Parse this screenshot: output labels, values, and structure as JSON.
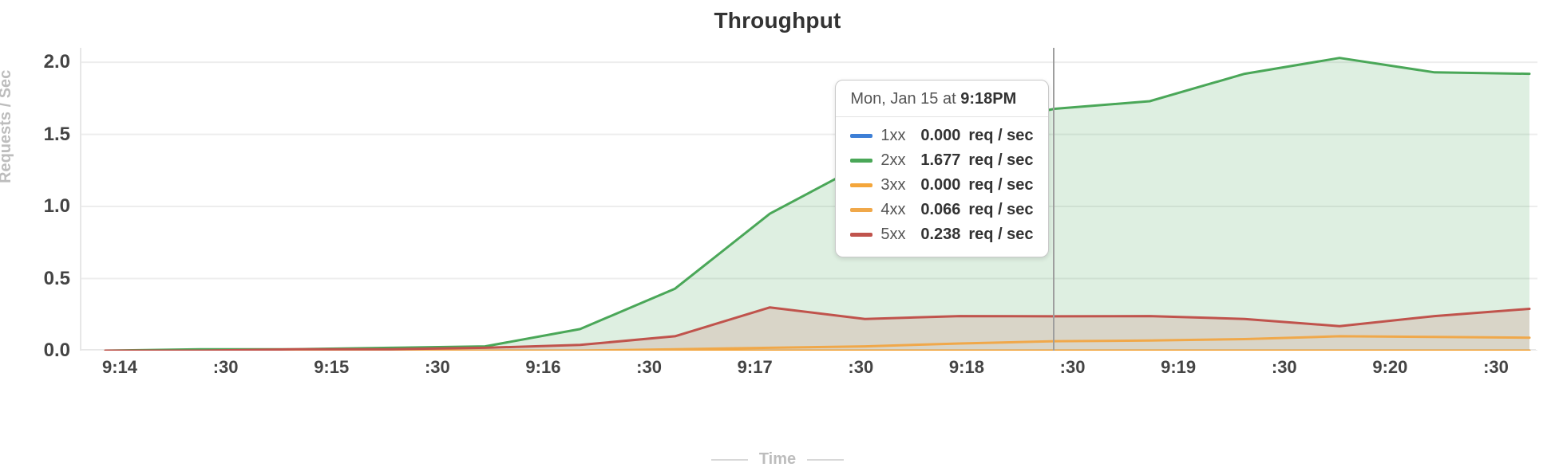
{
  "title": "Throughput",
  "ylabel": "Requests / Sec",
  "xlabel": "Time",
  "colors": {
    "s1xx": "#3d7fd6",
    "s2xx": "#4aa758",
    "s2xx_fill": "rgba(74,167,88,0.18)",
    "s3xx": "#f4a63b",
    "s4xx": "#f0a84a",
    "s5xx": "#c0534c",
    "s5xx_fill": "rgba(192,83,76,0.16)"
  },
  "y_ticks": [
    "0.0",
    "0.5",
    "1.0",
    "1.5",
    "2.0"
  ],
  "x_ticks": [
    "9:14",
    ":30",
    "9:15",
    ":30",
    "9:16",
    ":30",
    "9:17",
    ":30",
    "9:18",
    ":30",
    "9:19",
    ":30",
    "9:20",
    ":30"
  ],
  "tooltip": {
    "prefix": "Mon, Jan 15 at ",
    "time": "9:18PM",
    "unit": "req / sec",
    "rows": [
      {
        "label": "1xx",
        "value": "0.000",
        "colorKey": "s1xx"
      },
      {
        "label": "2xx",
        "value": "1.677",
        "colorKey": "s2xx"
      },
      {
        "label": "3xx",
        "value": "0.000",
        "colorKey": "s3xx"
      },
      {
        "label": "4xx",
        "value": "0.066",
        "colorKey": "s4xx"
      },
      {
        "label": "5xx",
        "value": "0.238",
        "colorKey": "s5xx"
      }
    ],
    "hover_x_label_index": 9
  },
  "chart_data": {
    "type": "area",
    "title": "Throughput",
    "xlabel": "Time",
    "ylabel": "Requests / Sec",
    "ylim": [
      0,
      2.1
    ],
    "x": [
      "9:14:00",
      "9:14:30",
      "9:15:00",
      "9:15:30",
      "9:16:00",
      "9:16:30",
      "9:17:00",
      "9:17:30",
      "9:18:00",
      "9:18:30",
      "9:18:48",
      "9:19:00",
      "9:19:30",
      "9:20:00",
      "9:20:30",
      "9:20:48"
    ],
    "series": [
      {
        "name": "1xx",
        "color": "#3d7fd6",
        "values": [
          0,
          0,
          0,
          0,
          0,
          0,
          0,
          0,
          0,
          0,
          0,
          0,
          0,
          0,
          0,
          0
        ]
      },
      {
        "name": "2xx",
        "color": "#4aa758",
        "fill": "rgba(74,167,88,0.18)",
        "values": [
          0.0,
          0.01,
          0.01,
          0.02,
          0.03,
          0.15,
          0.43,
          0.95,
          1.3,
          1.55,
          1.677,
          1.73,
          1.92,
          2.03,
          1.93,
          1.92
        ]
      },
      {
        "name": "3xx",
        "color": "#f4a63b",
        "values": [
          0,
          0,
          0,
          0,
          0,
          0,
          0,
          0,
          0,
          0,
          0,
          0,
          0,
          0,
          0,
          0
        ]
      },
      {
        "name": "4xx",
        "color": "#f0a84a",
        "values": [
          0,
          0,
          0,
          0,
          0,
          0,
          0.01,
          0.02,
          0.03,
          0.05,
          0.066,
          0.07,
          0.08,
          0.1,
          0.095,
          0.09
        ]
      },
      {
        "name": "5xx",
        "color": "#c0534c",
        "fill": "rgba(192,83,76,0.16)",
        "values": [
          0,
          0,
          0.01,
          0.01,
          0.02,
          0.04,
          0.1,
          0.3,
          0.22,
          0.24,
          0.238,
          0.24,
          0.22,
          0.17,
          0.24,
          0.29
        ]
      }
    ],
    "tooltip_snapshot": {
      "x": "9:18:48",
      "values": {
        "1xx": 0.0,
        "2xx": 1.677,
        "3xx": 0.0,
        "4xx": 0.066,
        "5xx": 0.238
      }
    }
  }
}
